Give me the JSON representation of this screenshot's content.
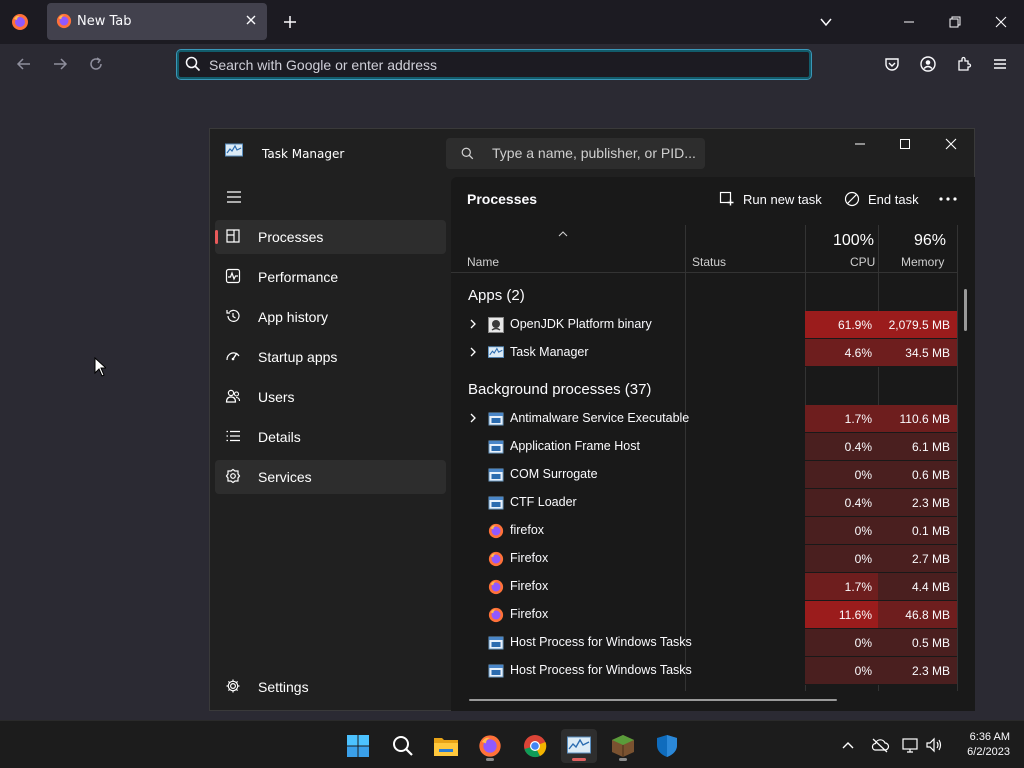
{
  "browser": {
    "tab_title": "New Tab",
    "url_placeholder": "Search with Google or enter address"
  },
  "task_manager": {
    "title": "Task Manager",
    "search_placeholder": "Type a name, publisher, or PID...",
    "nav": [
      {
        "label": "Processes",
        "icon": "processes-icon",
        "selected": true
      },
      {
        "label": "Performance",
        "icon": "performance-icon"
      },
      {
        "label": "App history",
        "icon": "history-icon"
      },
      {
        "label": "Startup apps",
        "icon": "startup-icon"
      },
      {
        "label": "Users",
        "icon": "users-icon"
      },
      {
        "label": "Details",
        "icon": "details-icon"
      },
      {
        "label": "Services",
        "icon": "services-icon",
        "hovered": true
      }
    ],
    "settings_label": "Settings",
    "header": {
      "title": "Processes",
      "run_new_task": "Run new task",
      "end_task": "End task"
    },
    "columns": {
      "name": "Name",
      "status": "Status",
      "cpu_pct": "100%",
      "cpu": "CPU",
      "mem_pct": "96%",
      "memory": "Memory"
    },
    "groups": {
      "apps": "Apps (2)",
      "background": "Background processes (37)"
    },
    "apps": [
      {
        "name": "OpenJDK Platform binary",
        "cpu": "61.9%",
        "mem": "2,079.5 MB",
        "icon": "java-icon",
        "expandable": true
      },
      {
        "name": "Task Manager",
        "cpu": "4.6%",
        "mem": "34.5 MB",
        "icon": "taskmgr-icon",
        "expandable": true
      }
    ],
    "background": [
      {
        "name": "Antimalware Service Executable",
        "cpu": "1.7%",
        "mem": "110.6 MB",
        "icon": "window-icon",
        "expandable": true
      },
      {
        "name": "Application Frame Host",
        "cpu": "0.4%",
        "mem": "6.1 MB",
        "icon": "window-icon"
      },
      {
        "name": "COM Surrogate",
        "cpu": "0%",
        "mem": "0.6 MB",
        "icon": "window-icon"
      },
      {
        "name": "CTF Loader",
        "cpu": "0.4%",
        "mem": "2.3 MB",
        "icon": "window-icon"
      },
      {
        "name": "firefox",
        "cpu": "0%",
        "mem": "0.1 MB",
        "icon": "firefox-icon"
      },
      {
        "name": "Firefox",
        "cpu": "0%",
        "mem": "2.7 MB",
        "icon": "firefox-icon"
      },
      {
        "name": "Firefox",
        "cpu": "1.7%",
        "mem": "4.4 MB",
        "icon": "firefox-icon"
      },
      {
        "name": "Firefox",
        "cpu": "11.6%",
        "mem": "46.8 MB",
        "icon": "firefox-icon"
      },
      {
        "name": "Host Process for Windows Tasks",
        "cpu": "0%",
        "mem": "0.5 MB",
        "icon": "window-icon"
      },
      {
        "name": "Host Process for Windows Tasks",
        "cpu": "0%",
        "mem": "2.3 MB",
        "icon": "window-icon"
      }
    ]
  },
  "taskbar": {
    "time": "6:36 AM",
    "date": "6/2/2023"
  },
  "colors": {
    "heat_high": "#9b1c1c",
    "heat_mid": "#6e1e1e",
    "heat_low": "#4a1f1f",
    "accent": "#e95a5a"
  }
}
